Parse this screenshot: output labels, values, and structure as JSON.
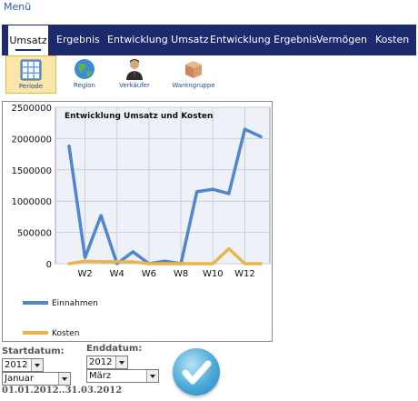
{
  "menu": {
    "label": "Menü"
  },
  "tabs": [
    {
      "label": "Umsatz",
      "active": true
    },
    {
      "label": "Ergebnis"
    },
    {
      "label": "Entwicklung Umsatz"
    },
    {
      "label": "Entwicklung Ergebnis"
    },
    {
      "label": "Vermögen"
    },
    {
      "label": "Kosten"
    }
  ],
  "subnav": [
    {
      "label": "Periode",
      "icon": "calendar-grid-icon",
      "selected": true
    },
    {
      "label": "Region",
      "icon": "globe-icon"
    },
    {
      "label": "Verkäufer",
      "icon": "salesperson-icon"
    },
    {
      "label": "Warengruppe",
      "icon": "box-icon"
    }
  ],
  "chart_data": {
    "type": "line",
    "title": "Entwicklung Umsatz und Kosten",
    "x": [
      "W1",
      "W2",
      "W3",
      "W4",
      "W5",
      "W6",
      "W7",
      "W8",
      "W9",
      "W10",
      "W11",
      "W12",
      "W13"
    ],
    "x_tick_labels": [
      "W2",
      "W4",
      "W6",
      "W8",
      "W10",
      "W12"
    ],
    "y_ticks": [
      0,
      500000,
      1000000,
      1500000,
      2000000,
      2500000
    ],
    "ylim": [
      0,
      2500000
    ],
    "grid": true,
    "legend_position": "bottom",
    "series": [
      {
        "name": "Einnahmen",
        "color": "#4f86d0",
        "values": [
          1880000,
          100000,
          770000,
          0,
          190000,
          0,
          40000,
          0,
          1150000,
          1190000,
          1120000,
          2150000,
          2030000
        ]
      },
      {
        "name": "Kosten",
        "color": "#e8b54c",
        "values": [
          0,
          40000,
          30000,
          30000,
          30000,
          0,
          0,
          0,
          0,
          0,
          240000,
          0,
          0
        ]
      }
    ]
  },
  "filters": {
    "start_label": "Startdatum:",
    "end_label": "Enddatum:",
    "start_year": "2012",
    "start_month": "Januar",
    "end_year": "2012",
    "end_month": "März",
    "range_text": "01.01.2012..31.03.2012"
  },
  "ok_button": {
    "icon": "checkmark-icon"
  }
}
